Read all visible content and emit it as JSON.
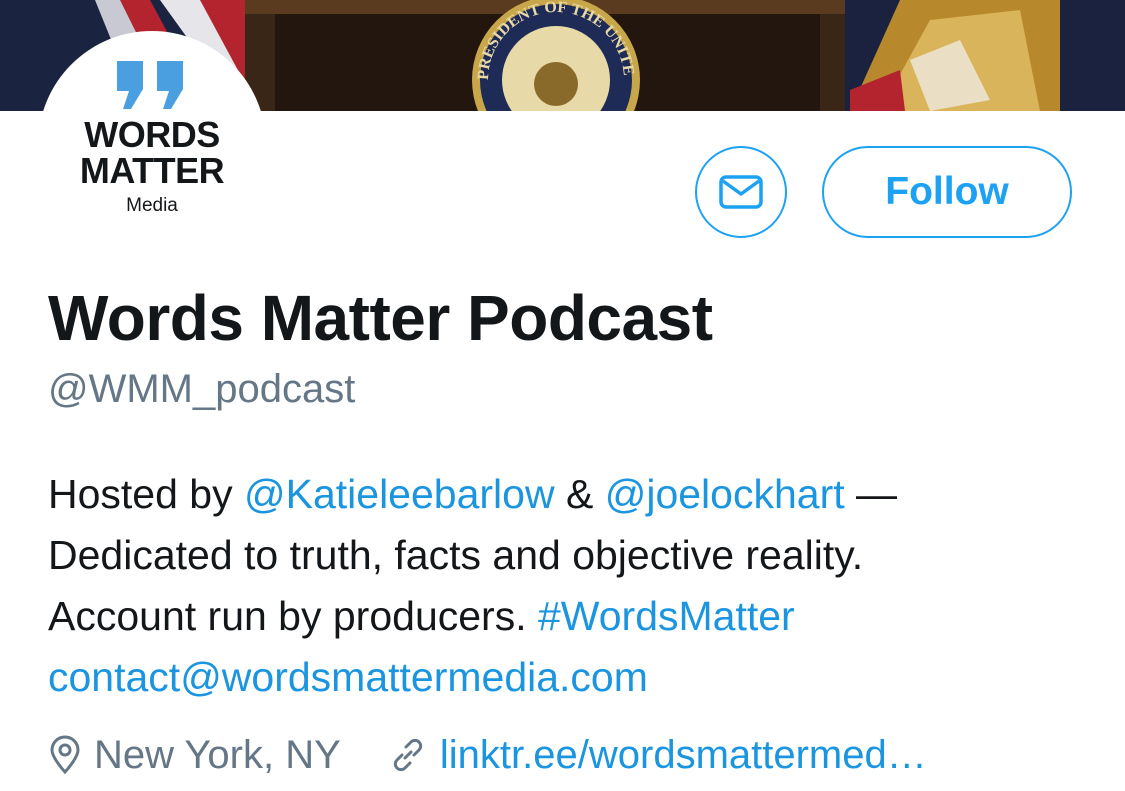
{
  "profile": {
    "name": "Words Matter Podcast",
    "handle": "@WMM_podcast",
    "logo": {
      "line1": "WORDS",
      "line2": "MATTER",
      "line3": "Media"
    },
    "follow_label": "Follow",
    "bio": {
      "p1_prefix": "Hosted by ",
      "mention1": "@Katieleebarlow",
      "p1_amp": " & ",
      "mention2": "@joelockhart",
      "p1_dash": " —",
      "line2": "Dedicated to truth, facts and objective reality.",
      "line3_prefix": "Account run by producers. ",
      "hashtag": "#WordsMatter",
      "email": "contact@wordsmattermedia.com"
    },
    "location": "New York, NY",
    "website": "linktr.ee/wordsmattermed…",
    "banner_seal_text": "PRESIDENT OF THE UNITED"
  },
  "colors": {
    "accent": "#1da1f2",
    "text": "#14171a",
    "muted": "#657786"
  },
  "icons": [
    "envelope-icon",
    "location-pin-icon",
    "link-icon",
    "quote-marks-icon"
  ]
}
